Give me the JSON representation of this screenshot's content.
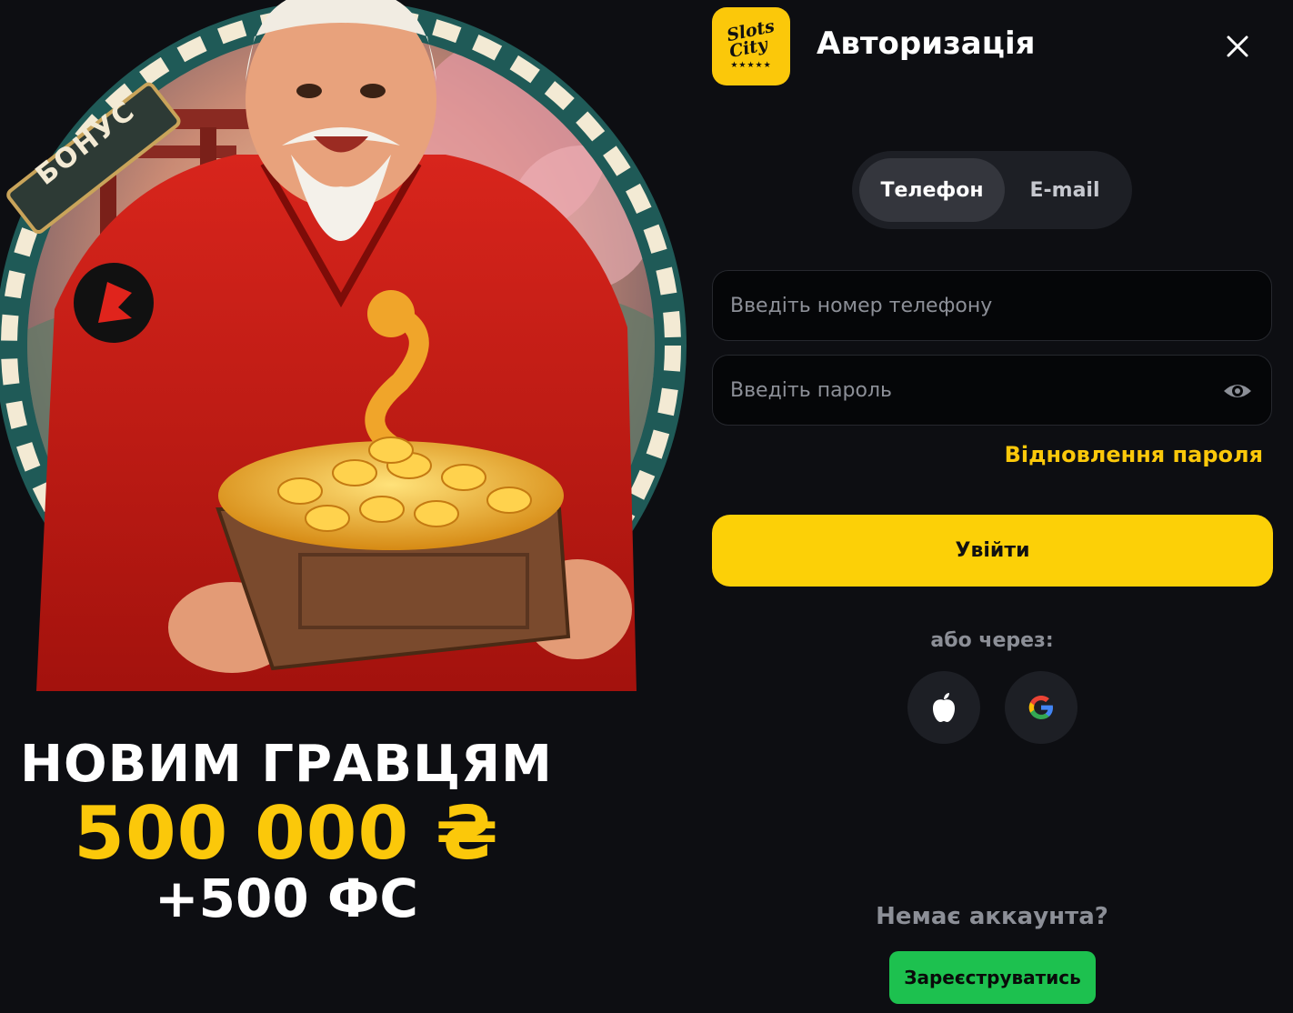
{
  "promo": {
    "badge_label": "БОНУС",
    "headline": "НОВИМ ГРАВЦЯМ",
    "amount": "500 000 ₴",
    "extra": "+500 ФС"
  },
  "logo": {
    "line1": "Slots",
    "line2": "City",
    "stars": "★★★★★"
  },
  "auth": {
    "title": "Авторизація",
    "tabs": [
      {
        "label": "Телефон",
        "active": true
      },
      {
        "label": "E-mail",
        "active": false
      }
    ],
    "phone_placeholder": "Введіть номер телефону",
    "password_placeholder": "Введіть пароль",
    "forgot_label": "Відновлення пароля",
    "login_label": "Увійти",
    "or_via": "або через:",
    "no_account": "Немає аккаунта?",
    "register_label": "Зареєструватись"
  },
  "colors": {
    "accent_yellow": "#fcd007",
    "register_green": "#1dc14f",
    "background": "#0d0e12"
  },
  "icons": [
    "close-icon",
    "eye-icon",
    "apple-icon",
    "google-icon"
  ]
}
